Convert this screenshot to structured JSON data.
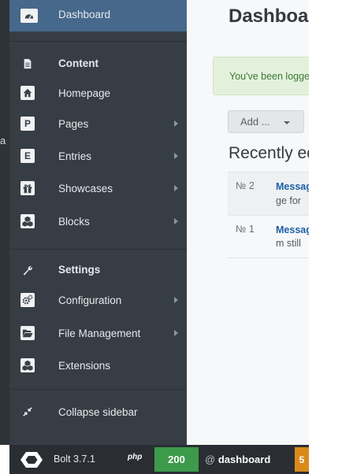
{
  "edge_text": "a",
  "sidebar": {
    "items": [
      {
        "label": "Dashboard",
        "icon": "dashboard-icon",
        "active": true
      },
      {
        "label": "Content",
        "icon": "file-icon",
        "section": true
      },
      {
        "label": "Homepage",
        "icon": "home-icon"
      },
      {
        "label": "Pages",
        "icon": "letter-p-icon",
        "glyph": "P",
        "submenu": true
      },
      {
        "label": "Entries",
        "icon": "letter-e-icon",
        "glyph": "E",
        "submenu": true
      },
      {
        "label": "Showcases",
        "icon": "gift-icon",
        "submenu": true
      },
      {
        "label": "Blocks",
        "icon": "cubes-icon",
        "submenu": true
      },
      {
        "label": "Settings",
        "icon": "wrench-icon",
        "section": true
      },
      {
        "label": "Configuration",
        "icon": "cogs-icon",
        "submenu": true
      },
      {
        "label": "File Management",
        "icon": "folder-open-icon",
        "submenu": true
      },
      {
        "label": "Extensions",
        "icon": "cubes-icon"
      },
      {
        "label": "Collapse sidebar",
        "icon": "compress-icon"
      }
    ]
  },
  "main": {
    "title": "Dashboard",
    "alert": "You've been logged on successfully.",
    "add_button": "Add ...",
    "section_title": "Recently edited",
    "records": [
      {
        "number": "№ 2",
        "title": "Message",
        "excerpt": "ge for"
      },
      {
        "number": "№ 1",
        "title": "Message",
        "excerpt": "m still"
      }
    ]
  },
  "footer": {
    "app": "Bolt 3.7.1",
    "php": "php",
    "status": "200",
    "route_prefix": "@",
    "route": "dashboard",
    "extra": "5"
  },
  "colors": {
    "sidebar_bg": "#373d44",
    "active_bg": "#46688b",
    "alert_bg": "#e3f1dc",
    "link": "#1d5fa8",
    "status_green": "#3d9a4a",
    "accent_orange": "#d98a1a"
  }
}
